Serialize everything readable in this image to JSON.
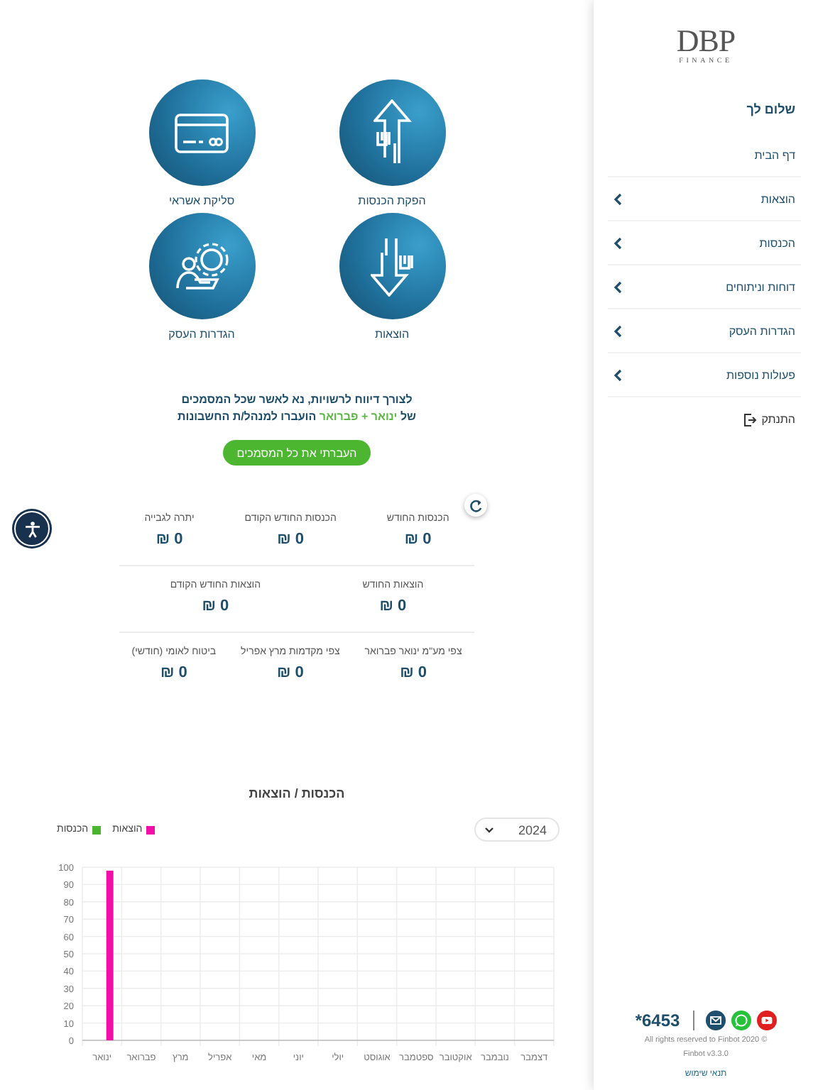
{
  "sidebar": {
    "logo": {
      "title": "DBP",
      "subtitle": "FINANCE"
    },
    "greeting": "שלום לך",
    "items": [
      {
        "label": "דף הבית",
        "expandable": false
      },
      {
        "label": "הוצאות",
        "expandable": true
      },
      {
        "label": "הכנסות",
        "expandable": true
      },
      {
        "label": "דוחות וניתוחים",
        "expandable": true
      },
      {
        "label": "הגדרות העסק",
        "expandable": true
      },
      {
        "label": "פעולות נוספות",
        "expandable": true
      }
    ],
    "logout": "התנתק",
    "footer": {
      "phone": "*6453",
      "copyright": "All rights reserved to Finbot 2020 ©",
      "version": "Finbot v3.3.0",
      "terms": "תנאי שימוש"
    }
  },
  "shortcuts": [
    {
      "kind": "income",
      "label": "הפקת הכנסות"
    },
    {
      "kind": "card",
      "label": "סליקת אשראי"
    },
    {
      "kind": "expense",
      "label": "הוצאות"
    },
    {
      "kind": "settings",
      "label": "הגדרות העסק"
    }
  ],
  "notice": {
    "before": "לצורך דיווח לרשויות, נא לאשר שכל המסמכים",
    "prefix": "של",
    "highlight": "ינואר + פברואר",
    "after": "הועברו למנהל/ת החשבונות",
    "button": "העברתי את כל המסמכים"
  },
  "stats": [
    [
      {
        "label": "הכנסות החודש",
        "value": "0",
        "currency": "₪"
      },
      {
        "label": "הכנסות החודש הקודם",
        "value": "0",
        "currency": "₪"
      },
      {
        "label": "יתרה לגבייה",
        "value": "0",
        "currency": "₪"
      }
    ],
    [
      {
        "label": "הוצאות החודש",
        "value": "0",
        "currency": "₪"
      },
      {
        "label": "הוצאות החודש הקודם",
        "value": "0",
        "currency": "₪"
      }
    ],
    [
      {
        "label": "צפי מע\"מ ינואר פברואר",
        "value": "0",
        "currency": "₪"
      },
      {
        "label": "צפי מקדמות מרץ אפריל",
        "value": "0",
        "currency": "₪"
      },
      {
        "label": "ביטוח לאומי (חודשי)",
        "value": "0",
        "currency": "₪"
      }
    ]
  ],
  "chart": {
    "title": "הכנסות / הוצאות",
    "year": "2024",
    "chart_data": {
      "type": "bar",
      "categories": [
        "ינואר",
        "פברואר",
        "מרץ",
        "אפריל",
        "מאי",
        "יוני",
        "יולי",
        "אוגוסט",
        "ספטמבר",
        "אוקטובר",
        "נובמבר",
        "דצמבר"
      ],
      "series": [
        {
          "name": "הוצאות",
          "color": "#f20fa8",
          "values": [
            98,
            0,
            0,
            0,
            0,
            0,
            0,
            0,
            0,
            0,
            0,
            0
          ]
        },
        {
          "name": "הכנסות",
          "color": "#4cb530",
          "values": [
            0,
            0,
            0,
            0,
            0,
            0,
            0,
            0,
            0,
            0,
            0,
            0
          ]
        }
      ],
      "grid": true,
      "ylim": [
        0,
        100
      ],
      "yticks": [
        0,
        10,
        20,
        30,
        40,
        50,
        60,
        70,
        80,
        90,
        100
      ]
    }
  }
}
